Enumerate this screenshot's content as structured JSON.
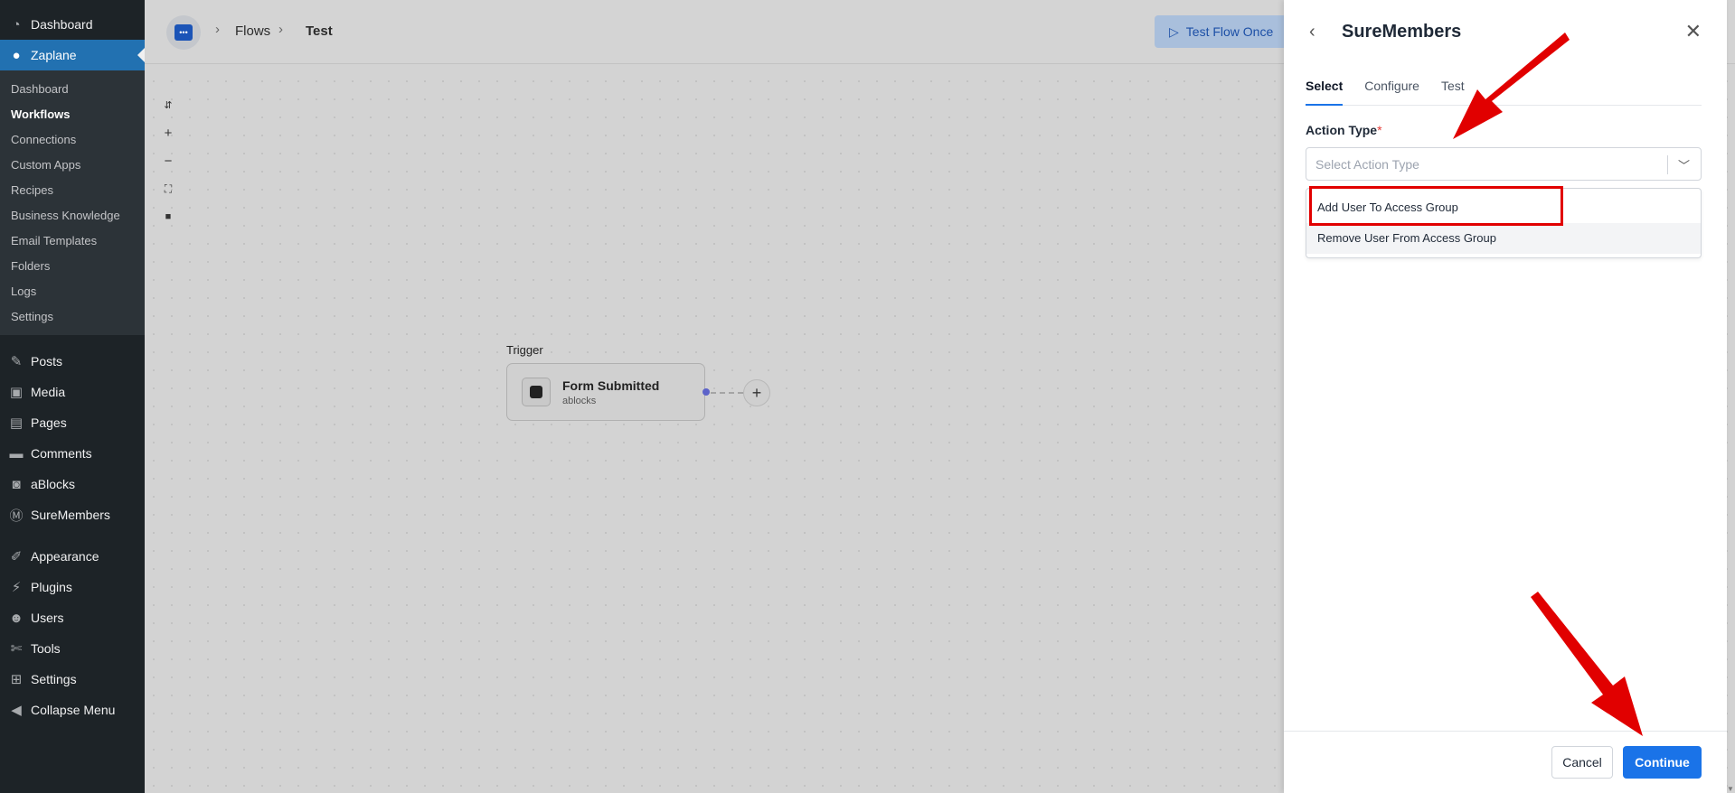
{
  "sidebar": {
    "top_items": [
      {
        "label": "Dashboard",
        "icon": "dashboard-icon"
      },
      {
        "label": "Zaplane",
        "icon": "zaplane-icon"
      }
    ],
    "submenu": [
      {
        "label": "Dashboard"
      },
      {
        "label": "Workflows"
      },
      {
        "label": "Connections"
      },
      {
        "label": "Custom Apps"
      },
      {
        "label": "Recipes"
      },
      {
        "label": "Business Knowledge"
      },
      {
        "label": "Email Templates"
      },
      {
        "label": "Folders"
      },
      {
        "label": "Logs"
      },
      {
        "label": "Settings"
      }
    ],
    "group_a": [
      {
        "label": "Posts",
        "icon": "pin-icon"
      },
      {
        "label": "Media",
        "icon": "media-icon"
      },
      {
        "label": "Pages",
        "icon": "pages-icon"
      },
      {
        "label": "Comments",
        "icon": "comments-icon"
      },
      {
        "label": "aBlocks",
        "icon": "ablocks-icon"
      },
      {
        "label": "SureMembers",
        "icon": "suremembers-icon"
      }
    ],
    "group_b": [
      {
        "label": "Appearance",
        "icon": "brush-icon"
      },
      {
        "label": "Plugins",
        "icon": "plug-icon"
      },
      {
        "label": "Users",
        "icon": "user-icon"
      },
      {
        "label": "Tools",
        "icon": "wrench-icon"
      },
      {
        "label": "Settings",
        "icon": "settings-icon"
      },
      {
        "label": "Collapse Menu",
        "icon": "collapse-icon"
      }
    ]
  },
  "topbar": {
    "breadcrumb": [
      "Flows",
      "Test"
    ],
    "test_flow_label": "Test Flow Once"
  },
  "canvas": {
    "trigger_label": "Trigger",
    "node_title": "Form Submitted",
    "node_subtitle": "ablocks"
  },
  "drawer": {
    "title": "SureMembers",
    "tabs": [
      "Select",
      "Configure",
      "Test"
    ],
    "field_label": "Action Type",
    "required_mark": "*",
    "select_placeholder": "Select Action Type",
    "options": [
      "Add User To Access Group",
      "Remove User From Access Group"
    ],
    "cancel_label": "Cancel",
    "continue_label": "Continue"
  },
  "colors": {
    "wp_sidebar": "#1d2327",
    "wp_active": "#2271b1",
    "primary_blue": "#1a73e8",
    "annotation_red": "#e10000"
  }
}
